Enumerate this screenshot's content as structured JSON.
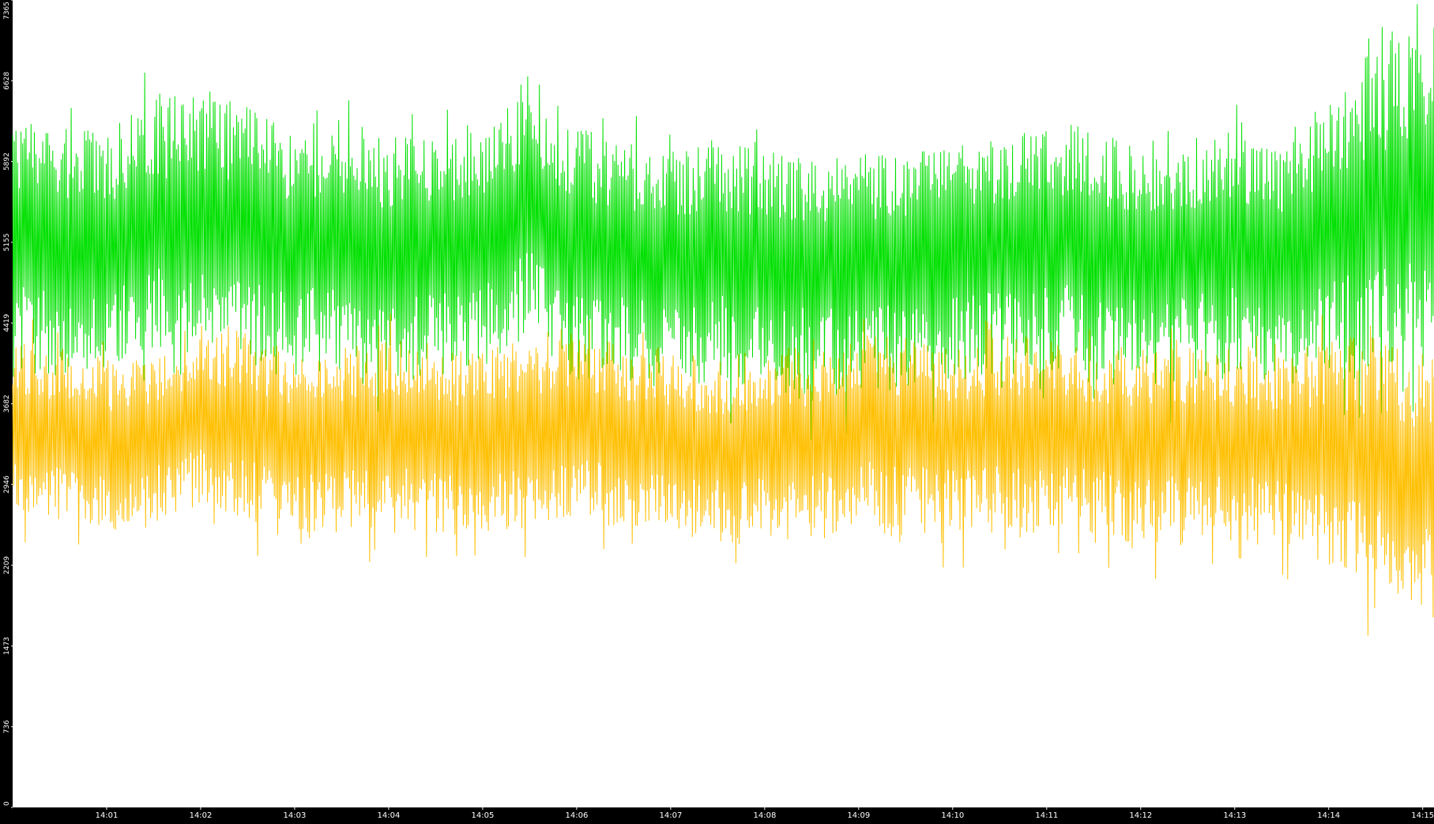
{
  "chart_data": {
    "type": "line",
    "title": "",
    "xlabel": "",
    "ylabel": "",
    "grid": false,
    "legend": "none",
    "background": "#ffffff",
    "axis_background": "#000000",
    "axis_text_color": "#ffffff",
    "ylim": [
      0,
      7365
    ],
    "y_ticks": [
      "0",
      "736",
      "1473",
      "2209",
      "2946",
      "3682",
      "4419",
      "5155",
      "5892",
      "6628",
      "7365"
    ],
    "x_range_minutes": [
      0,
      15.12
    ],
    "x_ticks": [
      {
        "label": "14:01",
        "minute": 1
      },
      {
        "label": "14:02",
        "minute": 2
      },
      {
        "label": "14:03",
        "minute": 3
      },
      {
        "label": "14:04",
        "minute": 4
      },
      {
        "label": "14:05",
        "minute": 5
      },
      {
        "label": "14:06",
        "minute": 6
      },
      {
        "label": "14:07",
        "minute": 7
      },
      {
        "label": "14:08",
        "minute": 8
      },
      {
        "label": "14:09",
        "minute": 9
      },
      {
        "label": "14:10",
        "minute": 10
      },
      {
        "label": "14:11",
        "minute": 11
      },
      {
        "label": "14:12",
        "minute": 12
      },
      {
        "label": "14:13",
        "minute": 13
      },
      {
        "label": "14:14",
        "minute": 14
      },
      {
        "label": "14:15",
        "minute": 15
      }
    ],
    "series": [
      {
        "color": "#00e000",
        "x": [
          0.0,
          0.5,
          1.0,
          1.5,
          2.0,
          2.5,
          3.0,
          3.5,
          4.0,
          4.5,
          5.0,
          5.5,
          6.0,
          6.5,
          7.0,
          7.5,
          8.0,
          8.5,
          9.0,
          9.5,
          10.0,
          10.5,
          11.0,
          11.5,
          12.0,
          12.5,
          13.0,
          13.5,
          14.0,
          14.5,
          15.1
        ],
        "values": [
          5200,
          5100,
          5150,
          5300,
          5350,
          5250,
          5150,
          5200,
          5100,
          5150,
          5200,
          5500,
          5150,
          5100,
          5050,
          5100,
          5050,
          5000,
          5000,
          5050,
          5100,
          5150,
          5250,
          5150,
          5050,
          5100,
          5200,
          5050,
          5300,
          5400,
          5500
        ],
        "band_low": [
          4000,
          3900,
          4000,
          4200,
          4200,
          4000,
          3900,
          4000,
          3900,
          3900,
          4000,
          4300,
          3900,
          3900,
          3800,
          3900,
          3800,
          3700,
          3800,
          3800,
          3900,
          3900,
          4000,
          3900,
          3800,
          3900,
          3900,
          3800,
          4000,
          4000,
          4100
        ],
        "band_high": [
          6300,
          6200,
          6200,
          6500,
          6600,
          6400,
          6200,
          6300,
          6100,
          6200,
          6200,
          6700,
          6200,
          6100,
          6000,
          6100,
          6000,
          5900,
          6000,
          6000,
          6100,
          6200,
          6300,
          6200,
          6000,
          6100,
          6200,
          6000,
          6500,
          7000,
          7300
        ]
      },
      {
        "color": "#ffbf00",
        "x": [
          0.0,
          0.5,
          1.0,
          1.5,
          2.0,
          2.5,
          3.0,
          3.5,
          4.0,
          4.5,
          5.0,
          5.5,
          6.0,
          6.5,
          7.0,
          7.5,
          8.0,
          8.5,
          9.0,
          9.5,
          10.0,
          10.5,
          11.0,
          11.5,
          12.0,
          12.5,
          13.0,
          13.5,
          14.0,
          14.5,
          15.1
        ],
        "values": [
          3500,
          3400,
          3300,
          3400,
          3600,
          3500,
          3350,
          3400,
          3450,
          3400,
          3350,
          3450,
          3550,
          3400,
          3350,
          3300,
          3350,
          3350,
          3500,
          3450,
          3400,
          3450,
          3450,
          3400,
          3350,
          3400,
          3350,
          3300,
          3300,
          3150,
          3000
        ],
        "band_low": [
          2700,
          2600,
          2500,
          2600,
          2700,
          2600,
          2400,
          2500,
          2500,
          2500,
          2400,
          2500,
          2700,
          2500,
          2500,
          2400,
          2400,
          2400,
          2600,
          2500,
          2500,
          2500,
          2500,
          2500,
          2300,
          2400,
          2500,
          2400,
          2200,
          1900,
          1700
        ],
        "band_high": [
          4300,
          4200,
          4100,
          4200,
          4400,
          4300,
          4200,
          4200,
          4300,
          4200,
          4200,
          4300,
          4400,
          4200,
          4200,
          4100,
          4200,
          4200,
          4300,
          4300,
          4200,
          4300,
          4300,
          4200,
          4200,
          4200,
          4200,
          4100,
          4300,
          4300,
          4200
        ]
      }
    ]
  }
}
